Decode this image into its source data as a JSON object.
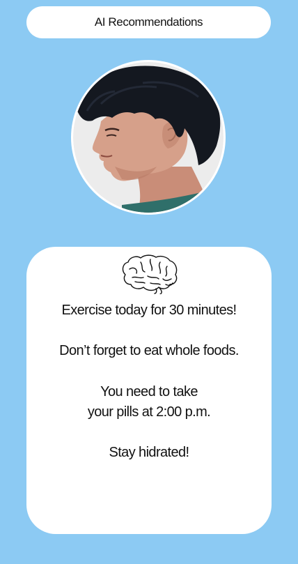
{
  "header": {
    "title": "AI Recommendations"
  },
  "profile": {
    "avatar_icon": "person-profile-photo"
  },
  "recommendations": {
    "icon": "brain-icon",
    "items": [
      {
        "lines": [
          "Exercise today for 30 minutes!"
        ]
      },
      {
        "lines": [
          "Don’t forget to eat whole foods."
        ]
      },
      {
        "lines": [
          "You need to take",
          "your pills at 2:00 p.m."
        ]
      },
      {
        "lines": [
          "Stay hidrated!"
        ]
      }
    ]
  },
  "colors": {
    "background": "#8ccaf3",
    "card": "#ffffff",
    "text": "#111111"
  }
}
